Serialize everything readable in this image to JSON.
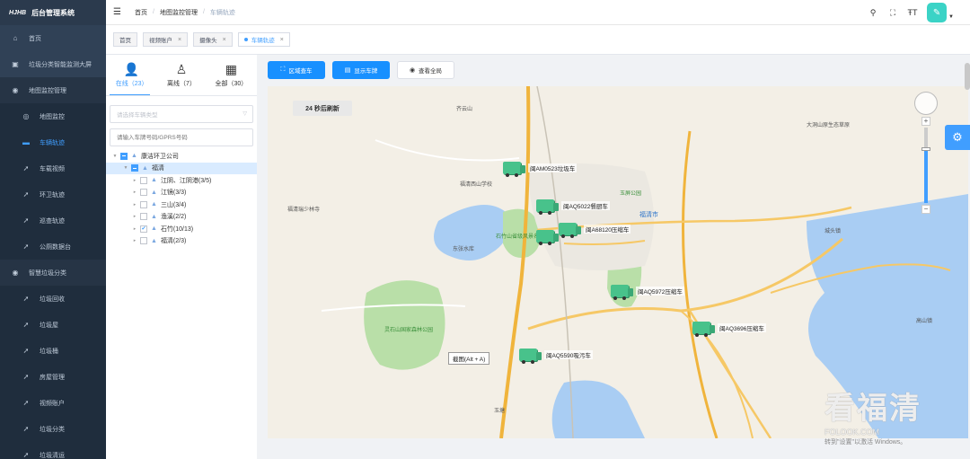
{
  "brand": {
    "logo": "HJHB",
    "title": "后台管理系统"
  },
  "sidebar": {
    "items": [
      {
        "label": "首页",
        "icon": "home-icon"
      },
      {
        "label": "垃圾分类智能监测大屏",
        "icon": "monitor-icon"
      },
      {
        "label": "地图监控管理",
        "icon": "user-icon"
      },
      {
        "label": "地图监控",
        "icon": "location-icon"
      },
      {
        "label": "车辆轨迹",
        "icon": "truck-icon"
      },
      {
        "label": "车载视频",
        "icon": "send-icon"
      },
      {
        "label": "环卫轨迹",
        "icon": "send-icon"
      },
      {
        "label": "巡查轨迹",
        "icon": "send-icon"
      },
      {
        "label": "公厕数据台",
        "icon": "send-icon"
      },
      {
        "label": "智慧垃圾分类",
        "icon": "user-icon"
      },
      {
        "label": "垃圾回收",
        "icon": "send-icon"
      },
      {
        "label": "垃圾屋",
        "icon": "send-icon"
      },
      {
        "label": "垃圾桶",
        "icon": "send-icon"
      },
      {
        "label": "房屋管理",
        "icon": "send-icon"
      },
      {
        "label": "视频账户",
        "icon": "send-icon"
      },
      {
        "label": "垃圾分类",
        "icon": "send-icon"
      },
      {
        "label": "垃圾清运",
        "icon": "send-icon"
      }
    ]
  },
  "breadcrumb": [
    "首页",
    "地图监控管理",
    "车辆轨迹"
  ],
  "tags": [
    "首页",
    "视频账户",
    "摄像头",
    "车辆轨迹"
  ],
  "status_tabs": [
    {
      "label": "在线（23）"
    },
    {
      "label": "离线（7）"
    },
    {
      "label": "全部（30）"
    }
  ],
  "filters": {
    "vehicle_type_placeholder": "请选择车辆类型",
    "plate_placeholder": "请输入车牌号码/GPRS号码"
  },
  "tree": [
    {
      "label": "康洁环卫公司",
      "level": 0,
      "state": "ind"
    },
    {
      "label": "福清",
      "level": 1,
      "state": "ind"
    },
    {
      "label": "江阴、江阴港(3/5)",
      "level": 2,
      "state": "none"
    },
    {
      "label": "江镜(3/3)",
      "level": 2,
      "state": "none"
    },
    {
      "label": "三山(3/4)",
      "level": 2,
      "state": "none"
    },
    {
      "label": "渔溪(2/2)",
      "level": 2,
      "state": "none"
    },
    {
      "label": "石竹(10/13)",
      "level": 2,
      "state": "chk"
    },
    {
      "label": "福清(2/3)",
      "level": 2,
      "state": "none"
    }
  ],
  "toolbar": {
    "area_search": "区域查车",
    "show_plate": "显示车牌",
    "view_all": "查看全局"
  },
  "map": {
    "refresh_text": "24 秒后刷新",
    "tooltip": "截图(Alt + A)",
    "places": [
      {
        "label": "齐云山",
        "cls": ""
      },
      {
        "label": "福清西山学校",
        "cls": ""
      },
      {
        "label": "福清瑞少林寺",
        "cls": ""
      },
      {
        "label": "石竹山省级风景名胜区",
        "cls": "green"
      },
      {
        "label": "玉屏公园",
        "cls": "green"
      },
      {
        "label": "福清市",
        "cls": "blue big"
      },
      {
        "label": "大洞山原生态草原",
        "cls": ""
      },
      {
        "label": "灵石山国家森林公园",
        "cls": "green"
      },
      {
        "label": "东张水库",
        "cls": ""
      },
      {
        "label": "玉塘",
        "cls": ""
      },
      {
        "label": "高山镇",
        "cls": ""
      },
      {
        "label": "城头镇",
        "cls": ""
      }
    ],
    "vehicles": [
      {
        "plate": "闽AM0523垃圾车"
      },
      {
        "plate": "闽AQ5022餐厨车"
      },
      {
        "plate": "闽A68120压缩车"
      },
      {
        "plate": "闽AQ5972压缩车"
      },
      {
        "plate": "闽AQ3696压缩车"
      },
      {
        "plate": "闽AQ5590吸污车"
      }
    ]
  },
  "watermark": {
    "main": "看福清",
    "sub": "FOLOOK.COM"
  },
  "activation": "转到\"设置\"以激活 Windows。"
}
